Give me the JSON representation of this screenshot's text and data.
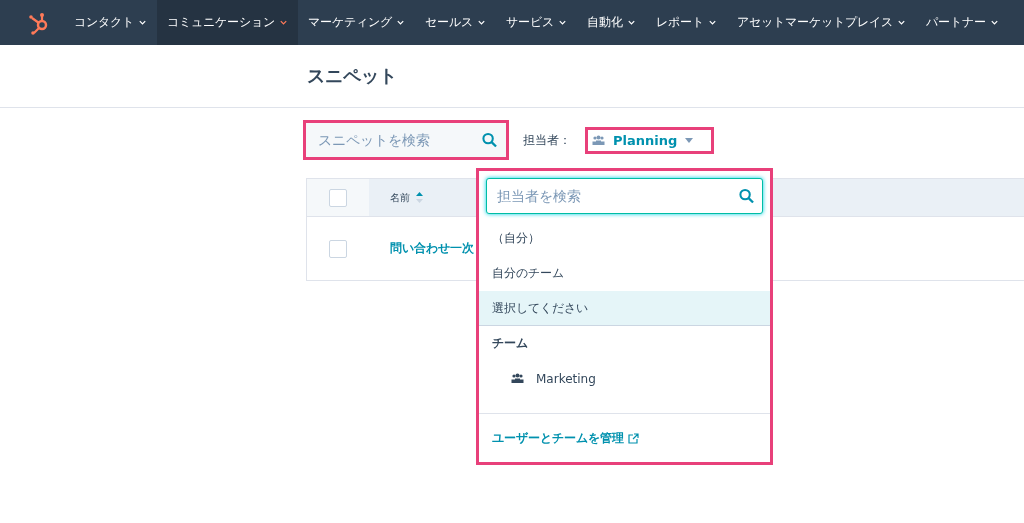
{
  "nav": {
    "items": [
      {
        "label": "コンタクト",
        "selected": false
      },
      {
        "label": "コミュニケーション",
        "selected": true
      },
      {
        "label": "マーケティング",
        "selected": false
      },
      {
        "label": "セールス",
        "selected": false
      },
      {
        "label": "サービス",
        "selected": false
      },
      {
        "label": "自動化",
        "selected": false
      },
      {
        "label": "レポート",
        "selected": false
      },
      {
        "label": "アセットマーケットプレイス",
        "selected": false
      },
      {
        "label": "パートナー",
        "selected": false
      }
    ]
  },
  "page_title": "スニペット",
  "search": {
    "placeholder": "スニペットを検索"
  },
  "owner_filter": {
    "label": "担当者：",
    "value": "Planning"
  },
  "table": {
    "select_all_checked": false,
    "columns": [
      {
        "label": "名前",
        "sorted": true
      }
    ],
    "rows": [
      {
        "name": "問い合わせ一次",
        "checked": false
      }
    ]
  },
  "dropdown": {
    "search": {
      "placeholder": "担当者を検索"
    },
    "items": [
      {
        "kind": "option",
        "label": "（自分）",
        "selected": false
      },
      {
        "kind": "option",
        "label": "自分のチーム",
        "selected": false
      },
      {
        "kind": "option",
        "label": "選択してください",
        "selected": true
      },
      {
        "kind": "header",
        "label": "チーム"
      },
      {
        "kind": "team",
        "label": "Marketing",
        "selected": false
      }
    ],
    "footer_link": "ユーザーとチームを管理"
  }
}
